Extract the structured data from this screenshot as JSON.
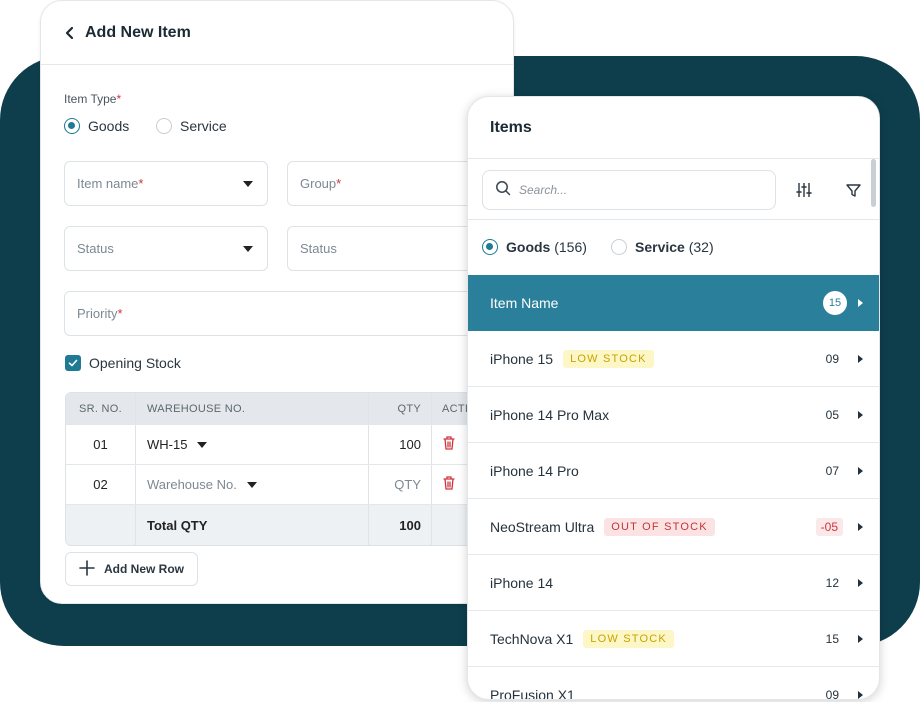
{
  "add_item": {
    "title": "Add New Item",
    "item_type_label": "Item Type",
    "required_mark": "*",
    "type_options": [
      "Goods",
      "Service"
    ],
    "selected_type": "Goods",
    "fields": {
      "item_name": "Item name",
      "group": "Group",
      "status_1": "Status",
      "status_2": "Status",
      "priority": "Priority"
    },
    "opening_stock_label": "Opening Stock",
    "opening_stock_checked": true,
    "table": {
      "headers": [
        "SR. NO.",
        "WAREHOUSE NO.",
        "QTY",
        "ACTIONS"
      ],
      "rows": [
        {
          "sr": "01",
          "warehouse": "WH-15",
          "qty": "100"
        },
        {
          "sr": "02",
          "warehouse": "Warehouse No.",
          "qty": "QTY"
        }
      ],
      "total_label": "Total QTY",
      "total_value": "100"
    },
    "add_row_label": "Add New Row"
  },
  "items_panel": {
    "title": "Items",
    "search_placeholder": "Search...",
    "segments": [
      {
        "label": "Goods",
        "count": "(156)",
        "selected": true
      },
      {
        "label": "Service",
        "count": "(32)",
        "selected": false
      }
    ],
    "header_row": {
      "label": "Item Name",
      "count": "15"
    },
    "items": [
      {
        "name": "iPhone 15",
        "badge": "LOW STOCK",
        "badge_type": "low",
        "qty": "09"
      },
      {
        "name": "iPhone 14 Pro Max",
        "badge": "",
        "badge_type": "",
        "qty": "05"
      },
      {
        "name": "iPhone 14 Pro",
        "badge": "",
        "badge_type": "",
        "qty": "07"
      },
      {
        "name": "NeoStream Ultra",
        "badge": "OUT OF STOCK",
        "badge_type": "out",
        "qty": "-05"
      },
      {
        "name": "iPhone 14",
        "badge": "",
        "badge_type": "",
        "qty": "12"
      },
      {
        "name": "TechNova X1",
        "badge": "LOW STOCK",
        "badge_type": "low",
        "qty": "15"
      },
      {
        "name": "ProFusion X1",
        "badge": "",
        "badge_type": "",
        "qty": "09"
      }
    ]
  },
  "colors": {
    "backdrop": "#0e3e4c",
    "accent": "#2a7f9b",
    "required": "#d0353f",
    "low_stock": "#c6a500",
    "out_of_stock": "#c2363b"
  }
}
